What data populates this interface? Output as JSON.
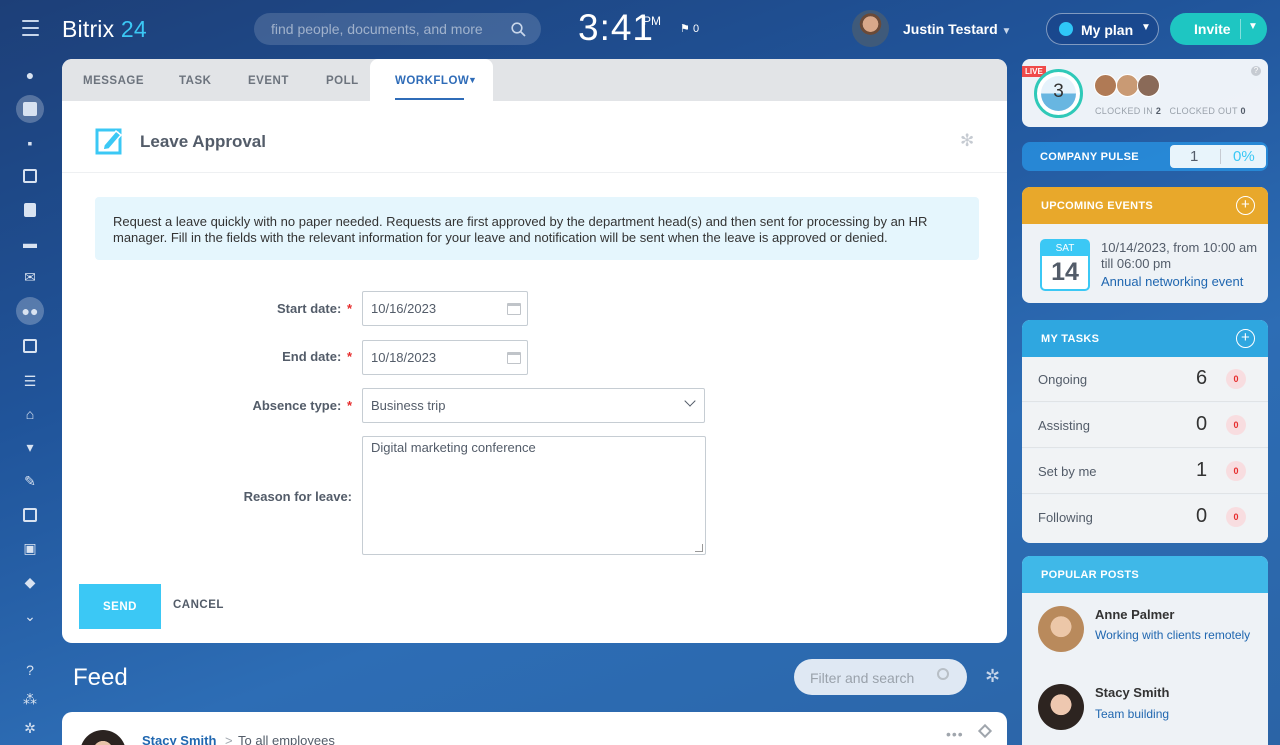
{
  "header": {
    "logo_main": "Bitrix",
    "logo_num": "24",
    "search_placeholder": "find people, documents, and more",
    "time": "3:41",
    "ampm": "PM",
    "flag_count": "0",
    "user_name": "Justin Testard",
    "myplan_label": "My plan",
    "invite_label": "Invite"
  },
  "sidebar_icons": [
    "dashboard-icon",
    "feed-icon",
    "chat-icon",
    "calendar-icon",
    "docs-icon",
    "drive-icon",
    "mail-icon",
    "groups-icon",
    "tasks-icon",
    "crm-icon",
    "store-icon",
    "shop-icon",
    "sign-icon",
    "contacts-icon",
    "robot-icon",
    "box-icon",
    "more-icon",
    "help-icon",
    "sitemap-icon",
    "settings-icon"
  ],
  "composer": {
    "tabs": [
      "MESSAGE",
      "TASK",
      "EVENT",
      "POLL"
    ],
    "active_tab": "WORKFLOW",
    "title": "Leave Approval",
    "info": "Request a leave quickly with no paper needed. Requests are first approved by the department head(s) and then sent for processing by an HR manager. Fill in the fields with the relevant information for your leave and notification will be sent when the leave is approved or denied.",
    "fields": {
      "start_label": "Start date:",
      "start_value": "10/16/2023",
      "end_label": "End date:",
      "end_value": "10/18/2023",
      "absence_label": "Absence type:",
      "absence_value": "Business trip",
      "reason_label": "Reason for leave:",
      "reason_value": "Digital marketing conference",
      "required_mark": "*"
    },
    "send_label": "SEND",
    "cancel_label": "CANCEL"
  },
  "feed": {
    "title": "Feed",
    "filter_placeholder": "Filter and search",
    "post_author": "Stacy Smith",
    "post_arrow": ">",
    "post_destination": "To all employees",
    "post_more": "•••"
  },
  "right": {
    "live": "LIVE",
    "clocked_count": "3",
    "clocked_in_label": "CLOCKED IN",
    "clocked_in": "2",
    "clocked_out_label": "CLOCKED OUT",
    "clocked_out": "0",
    "help": "?",
    "pulse_label": "COMPANY PULSE",
    "pulse_value": "1",
    "pulse_percent": "0%",
    "events_title": "UPCOMING EVENTS",
    "event_day": "SAT",
    "event_date": "14",
    "event_time": "10/14/2023, from 10:00 am till 06:00 pm",
    "event_name": "Annual networking event",
    "tasks_title": "MY TASKS",
    "tasks": [
      {
        "label": "Ongoing",
        "count": "6",
        "badge": "0"
      },
      {
        "label": "Assisting",
        "count": "0",
        "badge": "0"
      },
      {
        "label": "Set by me",
        "count": "1",
        "badge": "0"
      },
      {
        "label": "Following",
        "count": "0",
        "badge": "0"
      }
    ],
    "posts_title": "POPULAR POSTS",
    "posts": [
      {
        "author": "Anne Palmer",
        "text": "Working with clients remotely"
      },
      {
        "author": "Stacy Smith",
        "text": "Team building"
      }
    ],
    "plus": "+"
  }
}
